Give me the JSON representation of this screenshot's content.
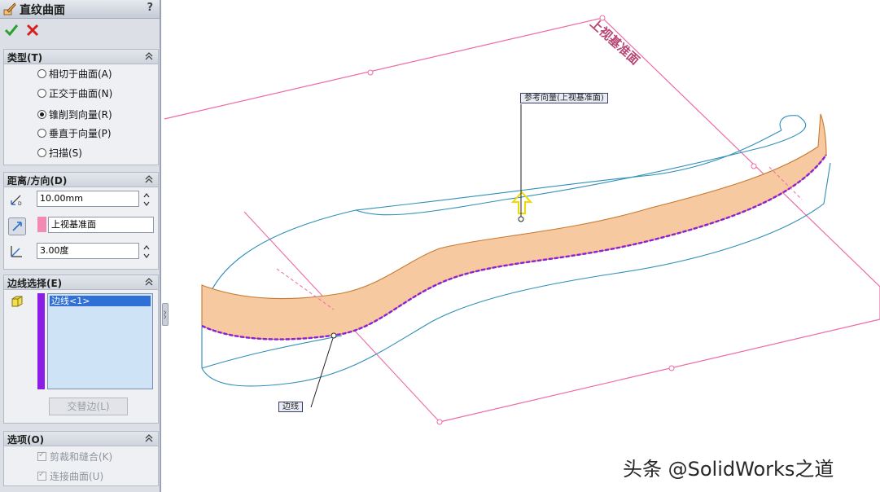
{
  "panel": {
    "title": "直纹曲面",
    "help": "?",
    "icons": {
      "ok": "check-icon",
      "cancel": "close-icon",
      "feature": "ruled-surface-icon"
    },
    "groups": {
      "type": {
        "title": "类型(T)",
        "options": [
          {
            "label": "相切于曲面(A)",
            "selected": false
          },
          {
            "label": "正交于曲面(N)",
            "selected": false
          },
          {
            "label": "锥削到向量(R)",
            "selected": true
          },
          {
            "label": "垂直于向量(P)",
            "selected": false
          },
          {
            "label": "扫描(S)",
            "selected": false
          }
        ]
      },
      "distance": {
        "title": "距离/方向(D)",
        "distance_value": "10.00mm",
        "reference": "上视基准面",
        "angle_value": "3.00度"
      },
      "edges": {
        "title": "边线选择(E)",
        "items": [
          "边线<1>"
        ],
        "alternate_button": "交替边(L)"
      },
      "options": {
        "title": "选项(O)",
        "items": [
          {
            "label": "剪裁和缝合(K)",
            "checked": true
          },
          {
            "label": "连接曲面(U)",
            "checked": true
          }
        ]
      }
    }
  },
  "viewport": {
    "plane_label": "上视基准面",
    "callout_reference": "参考向量(上视基准面)",
    "callout_edge": "边线",
    "colors": {
      "plane": "#ee6aa7",
      "surface": "#f4b98a",
      "edge": "#8a1de0",
      "outline": "#2f8fb8",
      "arrow": "#f3e43b"
    }
  },
  "watermark": "头条 @SolidWorks之道"
}
